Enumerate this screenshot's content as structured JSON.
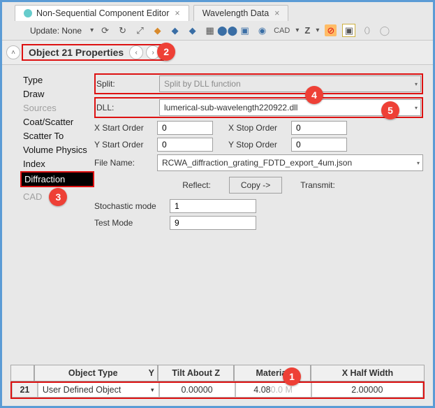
{
  "tabs": {
    "active_label": "Non-Sequential Component Editor",
    "inactive_label": "Wavelength Data"
  },
  "toolbar": {
    "update_label": "Update: None",
    "cad_label": "CAD",
    "z_label": "Z"
  },
  "propbar": {
    "title": "Object  21 Properties"
  },
  "cats": [
    "Type",
    "Draw",
    "Sources",
    "Coat/Scatter",
    "Scatter To",
    "Volume Physics",
    "Index",
    "Diffraction",
    "CAD"
  ],
  "form": {
    "split_label": "Split:",
    "split_value": "Split by DLL function",
    "dll_label": "DLL:",
    "dll_value": "lumerical-sub-wavelength220922.dll",
    "x_start_label": "X Start Order",
    "x_start_value": "0",
    "x_stop_label": "X Stop Order",
    "x_stop_value": "0",
    "y_start_label": "Y Start Order",
    "y_start_value": "0",
    "y_stop_label": "Y Stop Order",
    "y_stop_value": "0",
    "file_label": "File Name:",
    "file_value": "RCWA_diffraction_grating_FDTD_export_4um.json",
    "reflect_label": "Reflect:",
    "copy_label": "Copy ->",
    "transmit_label": "Transmit:",
    "stoch_label": "Stochastic mode",
    "stoch_value": "1",
    "test_label": "Test Mode",
    "test_value": "9"
  },
  "table": {
    "hdr_type": "Object Type",
    "hdr_sort": "Y",
    "hdr_tilt": "Tilt About Z",
    "hdr_mat": "Material",
    "hdr_xhw": "X Half Width",
    "row_num": "21",
    "row_type": "User Defined Object",
    "row_tilt": "0.00000",
    "row_mat": "4.08",
    "row_mat_b": "0.0  M",
    "row_xhw": "2.00000"
  },
  "badges": {
    "b1": "1",
    "b2": "2",
    "b3": "3",
    "b4": "4",
    "b5": "5"
  }
}
